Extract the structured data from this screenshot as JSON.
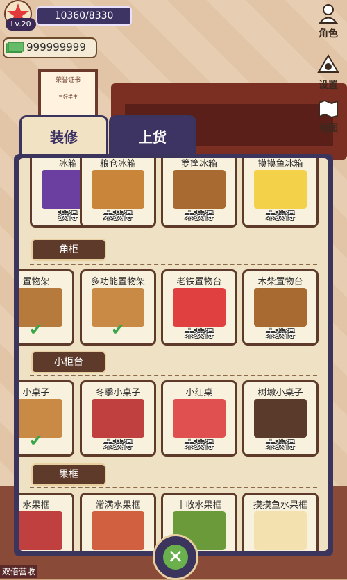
{
  "hud": {
    "level": "Lv.20",
    "xp": "10360/8330",
    "money": "999999999"
  },
  "side_buttons": [
    {
      "label": "角色",
      "icon": "character-icon"
    },
    {
      "label": "设置",
      "icon": "gear-icon"
    },
    {
      "label": "地图",
      "icon": "map-icon"
    }
  ],
  "background": {
    "certificate_title": "荣誉证书",
    "certificate_name": "三好学生"
  },
  "tabs": {
    "active": "装修",
    "inactive": "上货"
  },
  "rows": [
    {
      "section": null,
      "cards": [
        {
          "name": "冰箱",
          "status": "获得",
          "color": "#6b3fa0"
        },
        {
          "name": "粮仓冰箱",
          "status": "未获得",
          "color": "#c9863a"
        },
        {
          "name": "箩筐冰箱",
          "status": "未获得",
          "color": "#a86a30"
        },
        {
          "name": "摸摸鱼冰箱",
          "status": "未获得",
          "color": "#f3d24a"
        }
      ]
    },
    {
      "section": "角柜",
      "cards": [
        {
          "name": "置物架",
          "status": "",
          "owned": true,
          "color": "#b57a3c"
        },
        {
          "name": "多功能置物架",
          "status": "",
          "owned": true,
          "color": "#c98a46"
        },
        {
          "name": "老铁置物台",
          "status": "未获得",
          "color": "#e04040"
        },
        {
          "name": "木柴置物台",
          "status": "未获得",
          "color": "#a86a30"
        }
      ]
    },
    {
      "section": "小柜台",
      "cards": [
        {
          "name": "小桌子",
          "status": "",
          "owned": true,
          "color": "#c98a46"
        },
        {
          "name": "冬季小桌子",
          "status": "未获得",
          "color": "#c04040"
        },
        {
          "name": "小红桌",
          "status": "未获得",
          "color": "#e05050"
        },
        {
          "name": "树墩小桌子",
          "status": "未获得",
          "color": "#5a3a2a"
        }
      ]
    },
    {
      "section": "果框",
      "cards": [
        {
          "name": "水果框",
          "status": "",
          "color": "#c04040"
        },
        {
          "name": "常满水果框",
          "status": "",
          "color": "#d06040"
        },
        {
          "name": "丰收水果框",
          "status": "",
          "color": "#6a9a3a"
        },
        {
          "name": "摸摸鱼水果框",
          "status": "",
          "color": "#f3e2b0"
        }
      ]
    }
  ],
  "bottom_label": "双倍营收",
  "close": "close-icon"
}
